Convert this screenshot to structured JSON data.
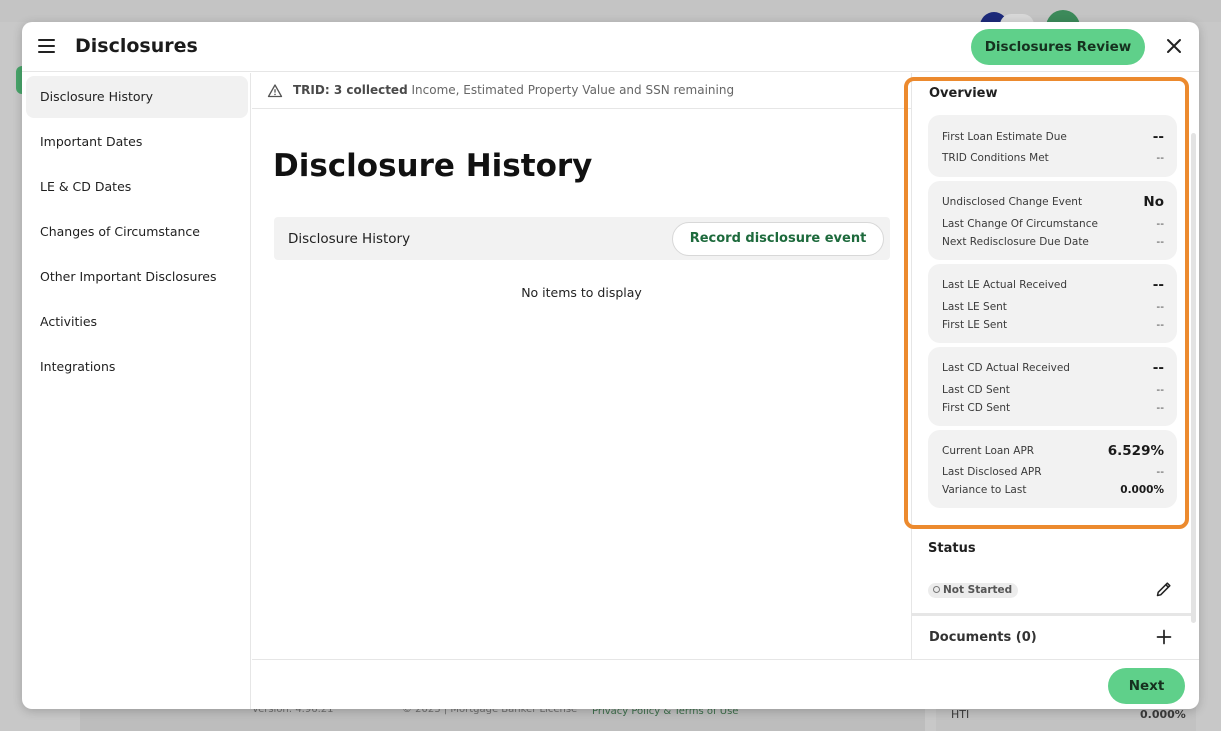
{
  "background": {
    "footer_version": "Version: 4.96.21",
    "footer_copyright": "© 2023 | Mortgage Banker License",
    "footer_link": "Privacy Policy & Terms of Use",
    "hti_label": "HTI",
    "hti_value": "0.000%"
  },
  "header": {
    "menu_icon": "hamburger-menu-icon",
    "title": "Disclosures",
    "review_button": "Disclosures Review",
    "close_icon": "close-icon"
  },
  "sidebar": {
    "items": [
      {
        "label": "Disclosure History",
        "active": true
      },
      {
        "label": "Important Dates",
        "active": false
      },
      {
        "label": "LE & CD Dates",
        "active": false
      },
      {
        "label": "Changes of Circumstance",
        "active": false
      },
      {
        "label": "Other Important Disclosures",
        "active": false
      },
      {
        "label": "Activities",
        "active": false
      },
      {
        "label": "Integrations",
        "active": false
      }
    ]
  },
  "banner": {
    "icon": "warning-icon",
    "bold": "TRID: 3 collected",
    "text": "Income, Estimated Property Value and SSN remaining"
  },
  "main": {
    "title": "Disclosure History",
    "section_title": "Disclosure History",
    "record_button": "Record disclosure event",
    "empty_text": "No items to display"
  },
  "overview": {
    "title": "Overview",
    "cards": [
      {
        "rows": [
          {
            "label": "First Loan Estimate Due",
            "value": "--"
          },
          {
            "label": "TRID Conditions Met",
            "value": "--"
          }
        ]
      },
      {
        "rows": [
          {
            "label": "Undisclosed Change Event",
            "value": "No"
          },
          {
            "label": "Last Change Of Circumstance",
            "value": "--"
          },
          {
            "label": "Next Redisclosure Due Date",
            "value": "--"
          }
        ]
      },
      {
        "rows": [
          {
            "label": "Last LE Actual Received",
            "value": "--"
          },
          {
            "label": "Last LE Sent",
            "value": "--"
          },
          {
            "label": "First LE Sent",
            "value": "--"
          }
        ]
      },
      {
        "rows": [
          {
            "label": "Last CD Actual Received",
            "value": "--"
          },
          {
            "label": "Last CD Sent",
            "value": "--"
          },
          {
            "label": "First CD Sent",
            "value": "--"
          }
        ]
      },
      {
        "rows": [
          {
            "label": "Current Loan APR",
            "value": "6.529%"
          },
          {
            "label": "Last Disclosed APR",
            "value": "--"
          },
          {
            "label": "Variance to Last",
            "value": "0.000%"
          }
        ]
      }
    ]
  },
  "status": {
    "title": "Status",
    "badge": "Not Started",
    "edit_icon": "pencil-icon"
  },
  "documents": {
    "title": "Documents (0)",
    "add_icon": "plus-icon"
  },
  "footer": {
    "next_button": "Next"
  },
  "colors": {
    "accent_green": "#5fd08a",
    "dark_green_text": "#1d6a3c",
    "highlight_orange": "#ec8a2e"
  }
}
